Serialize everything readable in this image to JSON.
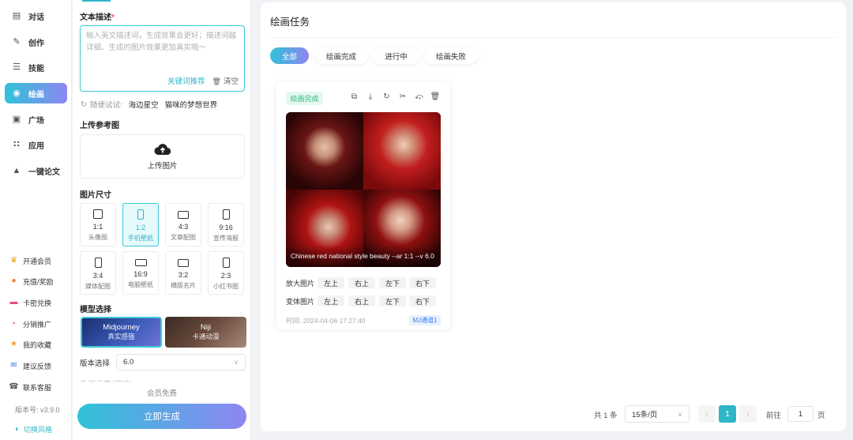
{
  "sidebar": {
    "nav": [
      {
        "label": "对话",
        "icon": "chat-icon"
      },
      {
        "label": "创作",
        "icon": "pen-icon"
      },
      {
        "label": "技能",
        "icon": "skill-list-icon"
      },
      {
        "label": "绘画",
        "icon": "palette-icon",
        "active": true
      },
      {
        "label": "广场",
        "icon": "image-icon"
      },
      {
        "label": "应用",
        "icon": "apps-grid-icon"
      },
      {
        "label": "一键论文",
        "icon": "graduation-cap-icon"
      }
    ],
    "bottom": [
      {
        "label": "开通会员",
        "icon": "crown-icon"
      },
      {
        "label": "充值/奖励",
        "icon": "coin-icon"
      },
      {
        "label": "卡密兑换",
        "icon": "card-icon"
      },
      {
        "label": "分销推广",
        "icon": "share-network-icon"
      },
      {
        "label": "我的收藏",
        "icon": "star-icon"
      },
      {
        "label": "建议反馈",
        "icon": "feedback-icon"
      },
      {
        "label": "联系客服",
        "icon": "headset-icon"
      }
    ],
    "version": "版本号: v3.9.0",
    "theme_toggle": "切换风格"
  },
  "panel": {
    "desc_title": "文本描述",
    "desc_required": "*",
    "desc_placeholder": "输入英文描述词，生成效果会更好；描述词越详细、生成的图片效果更加真实哦～",
    "keyword_btn": "关键词推荐",
    "clear_btn": "清空",
    "try_label": "随便试试:",
    "try_examples": [
      "海边星空",
      "猫咪的梦想世界"
    ],
    "upload_title": "上传参考图",
    "upload_label": "上传图片",
    "size_title": "图片尺寸",
    "sizes": [
      {
        "ratio": "1:1",
        "name": "头像图"
      },
      {
        "ratio": "1:2",
        "name": "手机壁纸",
        "active": true
      },
      {
        "ratio": "4:3",
        "name": "文章配图"
      },
      {
        "ratio": "9:16",
        "name": "宣传海报"
      },
      {
        "ratio": "3:4",
        "name": "媒体配图"
      },
      {
        "ratio": "16:9",
        "name": "电脑壁纸"
      },
      {
        "ratio": "3:2",
        "name": "横版名片"
      },
      {
        "ratio": "2:3",
        "name": "小红书图"
      }
    ],
    "model_title": "模型选择",
    "models": [
      {
        "name": "Midjourney",
        "sub": "真实感强",
        "active": true
      },
      {
        "name": "Niji",
        "sub": "卡通动漫"
      }
    ],
    "version_label": "版本选择",
    "version_value": "6.0",
    "cut_title": "负面示意(可选)",
    "free_text": "会员免费",
    "generate_btn": "立即生成"
  },
  "main": {
    "title": "绘画任务",
    "tabs": [
      {
        "label": "全部",
        "active": true
      },
      {
        "label": "绘画完成"
      },
      {
        "label": "进行中"
      },
      {
        "label": "绘画失败"
      }
    ],
    "card": {
      "status": "绘画完成",
      "actions": [
        "copy-icon",
        "download-icon",
        "refresh-icon",
        "scissors-icon",
        "share-icon",
        "trash-icon"
      ],
      "caption": "Chinese red national style beauty --ar 1:1 --v 6.0",
      "upscale_label": "放大图片",
      "variation_label": "变体图片",
      "positions": [
        "左上",
        "右上",
        "左下",
        "右下"
      ],
      "time": "时间: 2024-04-06 17:27:40",
      "channel": "MJ通道1"
    },
    "pagination": {
      "total": "共 1 条",
      "page_size": "15条/页",
      "current": "1",
      "goto_label": "前往",
      "goto_value": "1",
      "page_unit": "页"
    }
  }
}
